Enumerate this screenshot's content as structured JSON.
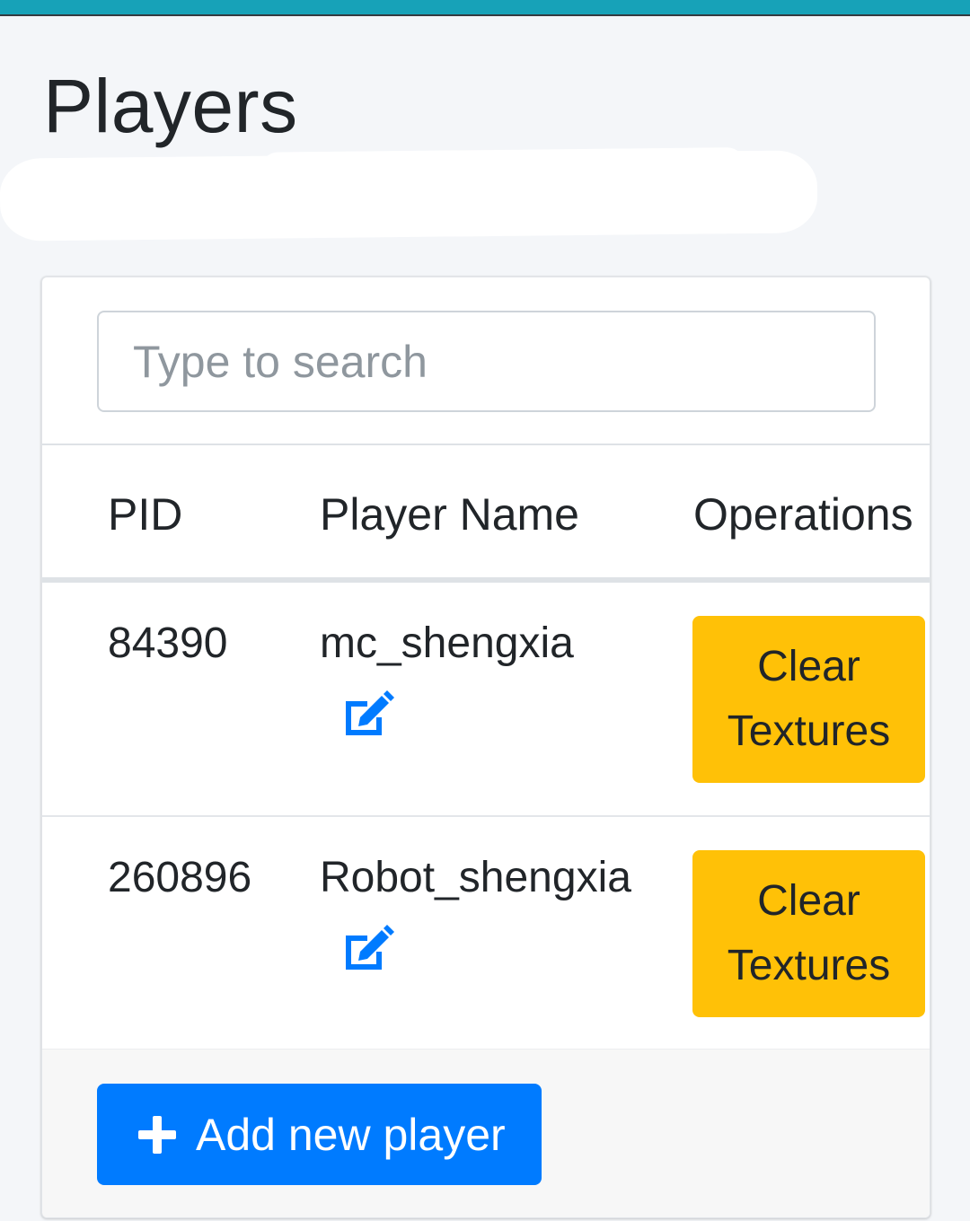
{
  "page": {
    "title": "Players"
  },
  "search": {
    "placeholder": "Type to search",
    "value": ""
  },
  "table": {
    "columns": [
      "PID",
      "Player Name",
      "Operations"
    ],
    "rows": [
      {
        "pid": "84390",
        "name": "mc_shengxia",
        "action_line1": "Clear",
        "action_line2": "Textures"
      },
      {
        "pid": "260896",
        "name": "Robot_shengxia",
        "action_line1": "Clear",
        "action_line2": "Textures"
      }
    ]
  },
  "footer": {
    "add_label": "Add new player"
  },
  "colors": {
    "topbar": "#17a2b8",
    "primary": "#007bff",
    "warning": "#ffc107",
    "edit_icon": "#007bff"
  },
  "icons": {
    "edit": "edit-icon",
    "add": "plus-icon"
  }
}
